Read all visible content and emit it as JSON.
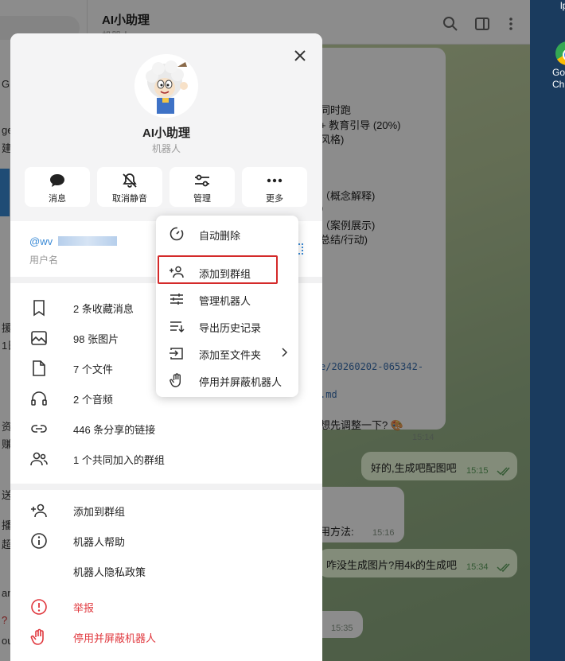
{
  "background": {
    "chat_title": "AI小助理",
    "chat_subtitle": "机器人",
    "left_fragments": [
      "G",
      "ge",
      "建",
      "援",
      "1日",
      "资",
      "赚",
      "送",
      "播",
      "超",
      "an.",
      "?",
      "ou"
    ],
    "messages_in": [
      "同时跑",
      "+ 教育引导 (20%)",
      "风格)",
      "（概念解释)",
      ")",
      "（案例展示)",
      "总结/行动)",
      "e/20260202-065342-",
      ".md",
      "想先调整一下? 🎨",
      "用方法:"
    ],
    "times": [
      "15:14",
      "15:16",
      "15:35"
    ],
    "messages_out": [
      {
        "text": "好的,生成吧配图吧",
        "time": "15:15"
      },
      {
        "text": "咋没生成图片?用4k的生成吧",
        "time": "15:34"
      }
    ],
    "desktop_label": "Go Ch",
    "desktop_top": "lp"
  },
  "profile": {
    "name": "AI小助理",
    "subtitle": "机器人",
    "actions": [
      "消息",
      "取消静音",
      "管理",
      "更多"
    ],
    "username_prefix": "@wv",
    "username_label": "用户名",
    "media_rows": [
      "2 条收藏消息",
      "98 张图片",
      "7 个文件",
      "2 个音频",
      "446 条分享的链接",
      "1 个共同加入的群组"
    ],
    "bottom_rows": [
      "添加到群组",
      "机器人帮助",
      "机器人隐私政策"
    ],
    "danger_rows": [
      "举报",
      "停用并屏蔽机器人"
    ]
  },
  "menu": {
    "items": [
      "自动删除",
      "添加到群组",
      "管理机器人",
      "导出历史记录",
      "添加至文件夹",
      "停用并屏蔽机器人"
    ]
  },
  "colors": {
    "accent": "#3a8ad6",
    "danger": "#e0383e",
    "highlight_box": "#d42a2a"
  }
}
